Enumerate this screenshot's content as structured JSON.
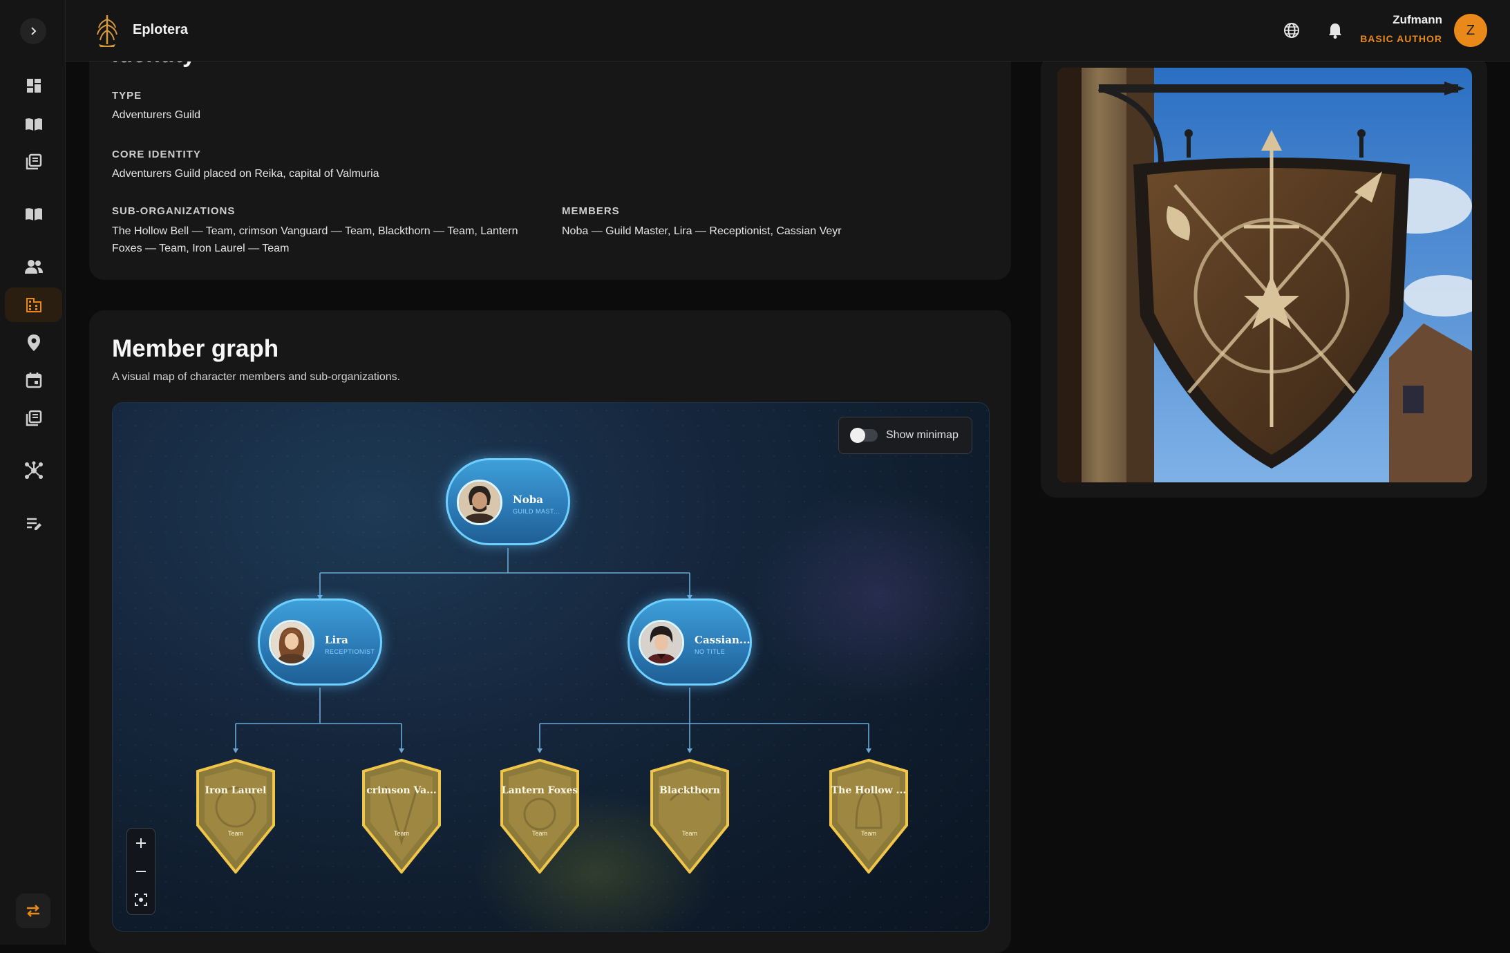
{
  "app": {
    "brand": "Eplotera"
  },
  "header": {
    "user_name": "Zufmann",
    "user_role": "BASIC AUTHOR",
    "avatar_initial": "Z"
  },
  "colors": {
    "accent": "#e8891a",
    "character_node": "#3f9fd8",
    "team_node": "#d9b24a"
  },
  "sidebar": {
    "items": [
      {
        "icon": "dashboard-icon"
      },
      {
        "icon": "book-open-icon"
      },
      {
        "icon": "library-icon"
      },
      {
        "icon": "book-icon"
      },
      {
        "icon": "people-icon"
      },
      {
        "icon": "organization-icon",
        "active": true
      },
      {
        "icon": "location-pin-icon"
      },
      {
        "icon": "calendar-icon"
      },
      {
        "icon": "notes-icon"
      },
      {
        "icon": "network-icon"
      },
      {
        "icon": "edit-list-icon"
      }
    ]
  },
  "identity": {
    "title": "Identity",
    "type_label": "TYPE",
    "type_value": "Adventurers Guild",
    "core_label": "CORE IDENTITY",
    "core_value": "Adventurers Guild placed on Reika, capital of Valmuria",
    "suborg_label": "SUB-ORGANIZATIONS",
    "suborg_value": "The Hollow Bell — Team, crimson Vanguard — Team, Blackthorn — Team, Lantern Foxes — Team, Iron Laurel — Team",
    "members_label": "MEMBERS",
    "members_value": "Noba — Guild Master, Lira — Receptionist, Cassian Veyr"
  },
  "graph": {
    "title": "Member graph",
    "subtitle": "A visual map of character members and sub-organizations.",
    "minimap_label": "Show minimap",
    "minimap_on": false,
    "characters": {
      "noba": {
        "name": "Noba",
        "title": "GUILD MAST..."
      },
      "lira": {
        "name": "Lira",
        "title": "RECEPTIONIST"
      },
      "cassian": {
        "name": "Cassian...",
        "title": "NO TITLE"
      }
    },
    "teams": {
      "iron_laurel": {
        "name": "Iron Laurel",
        "type": "Team"
      },
      "crimson": {
        "name": "crimson Va...",
        "type": "Team"
      },
      "lantern": {
        "name": "Lantern Foxes",
        "type": "Team"
      },
      "blackthorn": {
        "name": "Blackthorn",
        "type": "Team"
      },
      "hollow": {
        "name": "The Hollow ...",
        "type": "Team"
      }
    }
  }
}
